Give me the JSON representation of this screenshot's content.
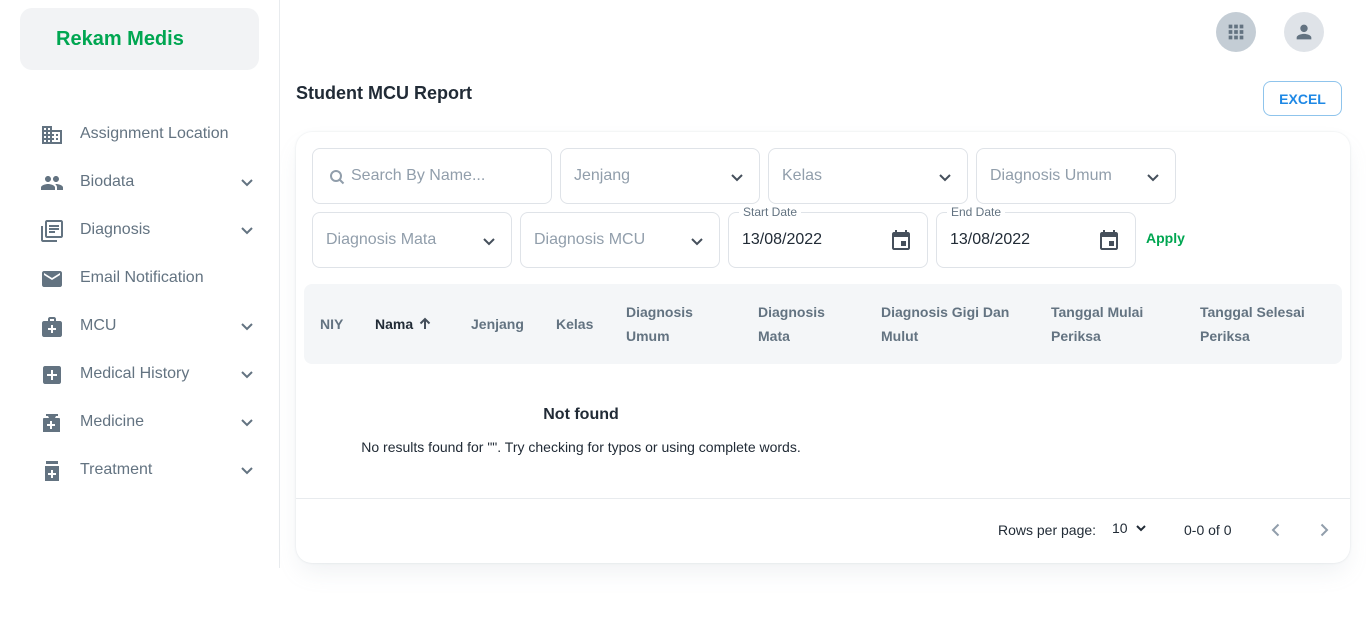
{
  "brand": {
    "title": "Rekam Medis"
  },
  "sidebar": {
    "items": [
      {
        "label": "Assignment Location",
        "icon": "building-icon",
        "expandable": false
      },
      {
        "label": "Biodata",
        "icon": "people-icon",
        "expandable": true
      },
      {
        "label": "Diagnosis",
        "icon": "document-list-icon",
        "expandable": true
      },
      {
        "label": "Email Notification",
        "icon": "mail-icon",
        "expandable": false
      },
      {
        "label": "MCU",
        "icon": "medical-bag-icon",
        "expandable": true
      },
      {
        "label": "Medical History",
        "icon": "medical-cross-icon",
        "expandable": true
      },
      {
        "label": "Medicine",
        "icon": "medicine-icon",
        "expandable": true
      },
      {
        "label": "Treatment",
        "icon": "pill-bottle-icon",
        "expandable": true
      }
    ]
  },
  "page": {
    "title": "Student MCU Report",
    "export_label": "EXCEL"
  },
  "filters": {
    "search_placeholder": "Search By Name...",
    "jenjang": "Jenjang",
    "kelas": "Kelas",
    "diagnosis_umum": "Diagnosis Umum",
    "diagnosis_mata": "Diagnosis Mata",
    "diagnosis_mcu": "Diagnosis MCU",
    "start_date_label": "Start Date",
    "start_date": "13/08/2022",
    "end_date_label": "End Date",
    "end_date": "13/08/2022",
    "apply_label": "Apply"
  },
  "table": {
    "columns": [
      {
        "line1": "NIY",
        "line2": ""
      },
      {
        "line1": "Nama",
        "line2": ""
      },
      {
        "line1": "Jenjang",
        "line2": ""
      },
      {
        "line1": "Kelas",
        "line2": ""
      },
      {
        "line1": "Diagnosis",
        "line2": "Umum"
      },
      {
        "line1": "Diagnosis",
        "line2": "Mata"
      },
      {
        "line1": "Diagnosis Gigi Dan",
        "line2": "Mulut"
      },
      {
        "line1": "Tanggal Mulai",
        "line2": "Periksa"
      },
      {
        "line1": "Tanggal Selesai",
        "line2": "Periksa"
      }
    ],
    "sorted_column": "Nama",
    "empty_title": "Not found",
    "empty_desc": "No results found for  \"\". Try checking for typos or using complete words."
  },
  "pagination": {
    "rows_per_page_label": "Rows per page:",
    "rows_per_page": "10",
    "range": "0-0 of 0"
  },
  "colors": {
    "brand": "#00a651",
    "accent": "#1e88e5",
    "text_muted": "#637381"
  }
}
